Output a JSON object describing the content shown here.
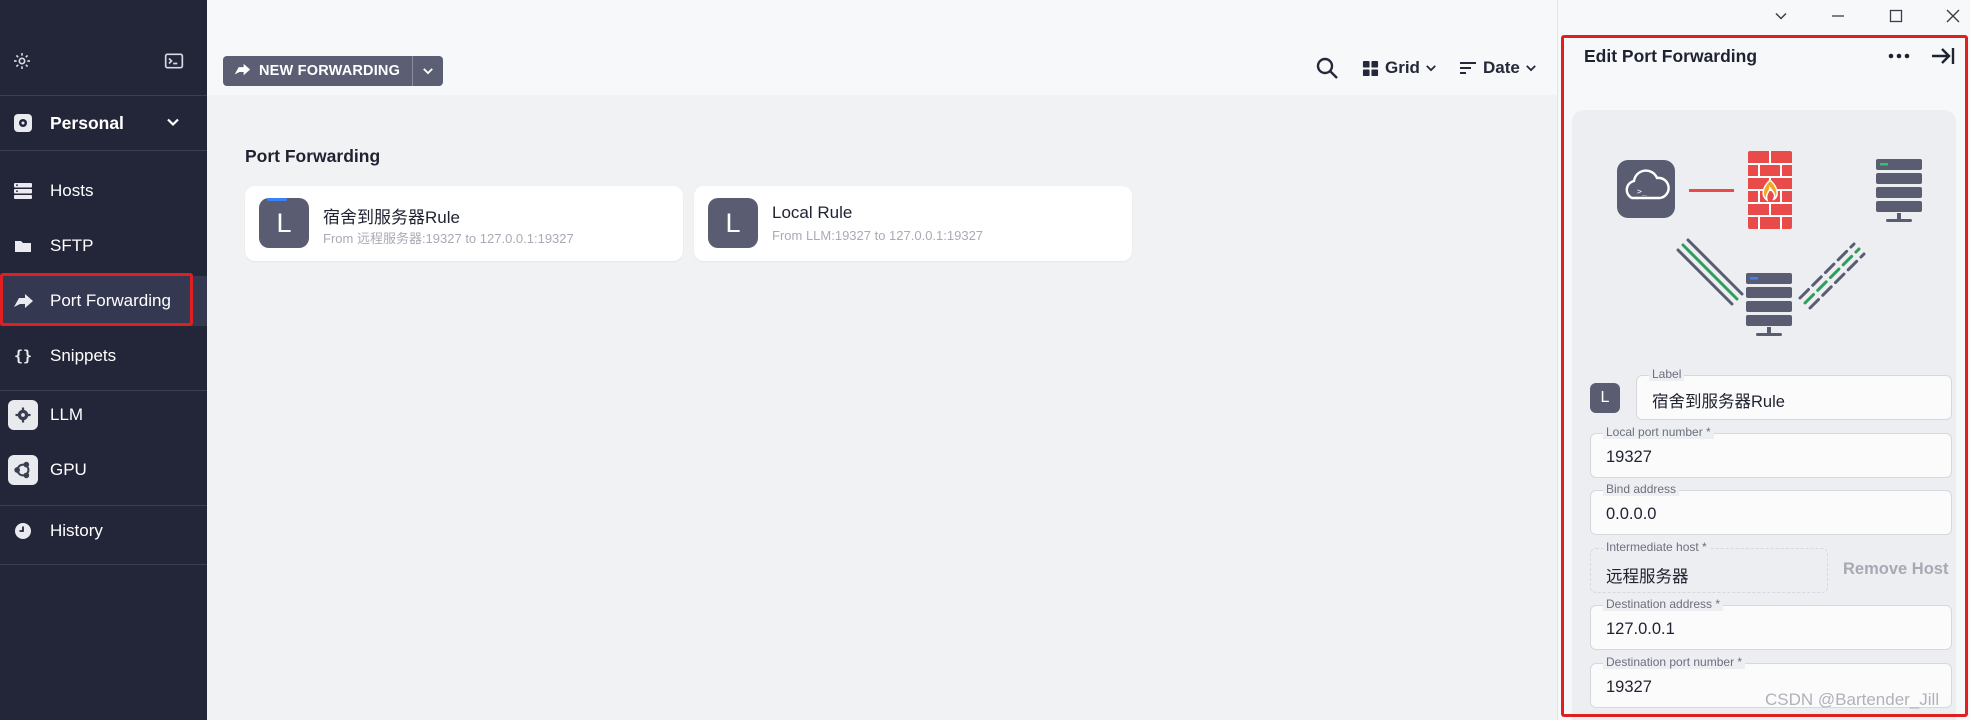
{
  "sidebar": {
    "top_icons": [
      "gear-icon",
      "terminal-icon"
    ],
    "vault": {
      "label": "Personal"
    },
    "items": [
      {
        "label": "Hosts",
        "icon": "hosts-icon"
      },
      {
        "label": "SFTP",
        "icon": "folder-icon"
      },
      {
        "label": "Port Forwarding",
        "icon": "forward-arrow-icon",
        "active": true
      },
      {
        "label": "Snippets",
        "icon": "braces-icon"
      }
    ],
    "hosts": [
      {
        "label": "LLM",
        "icon": "gear-badge-icon"
      },
      {
        "label": "GPU",
        "icon": "ubuntu-icon"
      }
    ],
    "history": {
      "label": "History",
      "icon": "clock-icon"
    }
  },
  "toolbar": {
    "new_label": "NEW FORWARDING",
    "view_label": "Grid",
    "sort_label": "Date"
  },
  "main": {
    "section_title": "Port Forwarding",
    "cards": [
      {
        "avatar": "L",
        "name": "宿舍到服务器Rule",
        "subtitle": "From 远程服务器:19327 to 127.0.0.1:19327"
      },
      {
        "avatar": "L",
        "name": "Local Rule",
        "subtitle": "From LLM:19327 to 127.0.0.1:19327"
      }
    ]
  },
  "panel": {
    "title": "Edit Port Forwarding",
    "label_avatar": "L",
    "fields": {
      "label": {
        "label": "Label",
        "value": "宿舍到服务器Rule"
      },
      "local_port": {
        "label": "Local port number *",
        "value": "19327"
      },
      "bind_address": {
        "label": "Bind address",
        "value": "0.0.0.0"
      },
      "intermediate_host": {
        "label": "Intermediate host *",
        "value": "远程服务器"
      },
      "destination_address": {
        "label": "Destination address *",
        "value": "127.0.0.1"
      },
      "destination_port": {
        "label": "Destination port number *",
        "value": "19327"
      }
    },
    "remove_host_label": "Remove Host"
  },
  "watermark": "CSDN @Bartender_Jill",
  "colors": {
    "sidebar_bg": "#232638",
    "accent": "#5c5f74",
    "highlight_box": "#e02020",
    "firewall": "#e94b4b",
    "tunnel_green": "#2f9e5b"
  }
}
